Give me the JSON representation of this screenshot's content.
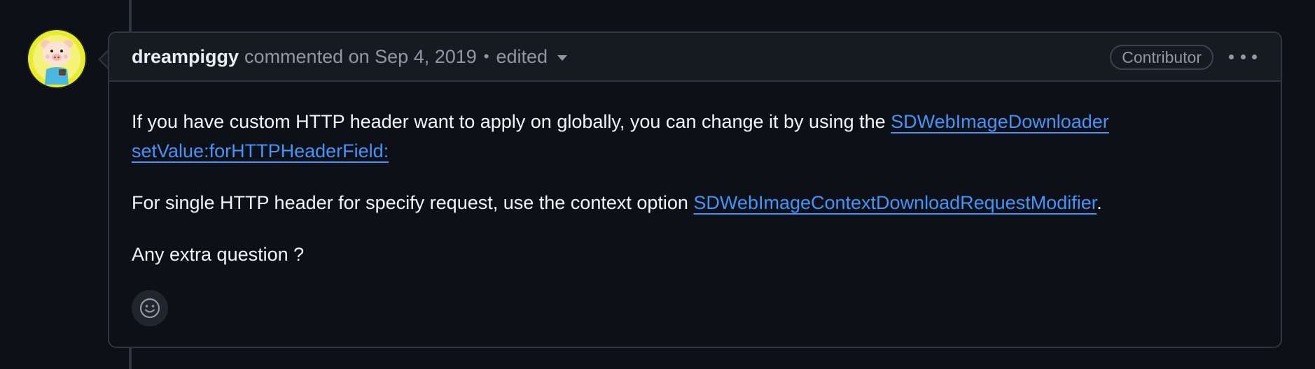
{
  "comment": {
    "author": "dreampiggy",
    "meta_text": "commented on Sep 4, 2019",
    "separator": "•",
    "edited_label": "edited",
    "badge": "Contributor",
    "body": {
      "p1_text": "If you have custom HTTP header want to apply on globally, you can change it by using the ",
      "p1_link": "SDWebImageDownloader setValue:forHTTPHeaderField:",
      "p2_text": "For single HTTP header for specify request, use the context option ",
      "p2_link": "SDWebImageContextDownloadRequestModifier",
      "p2_suffix": ".",
      "p3_text": "Any extra question ?"
    }
  },
  "icons": {
    "avatar": "pig-avatar",
    "menu": "kebab-horizontal-icon",
    "reaction": "smiley-icon",
    "dropdown": "triangle-down-icon"
  },
  "colors": {
    "background": "#0d1117",
    "header_bg": "#161b22",
    "border": "#30363d",
    "link": "#4493f8",
    "muted": "#9198a1",
    "text": "#f0f6fc"
  }
}
